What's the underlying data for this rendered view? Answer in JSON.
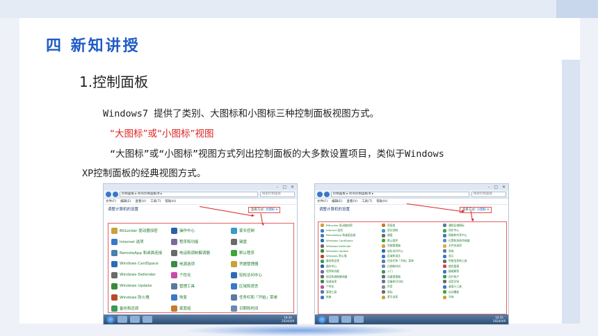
{
  "slide": {
    "section_title": "四 新知讲授",
    "sub_title": "1.控制面板",
    "para1": "Windows7 提供了类别、大图标和小图标三种控制面板视图方式。",
    "para2_highlight": "“大图标”或“小图标”视图",
    "para3": "“大图标”或“小图标”视图方式列出控制面板的大多数设置项目，类似于Windows",
    "para4": "XP控制面板的经典视图方式。"
  },
  "left_window": {
    "path": "控制面板 ▸ 所有控制面板项 ▸",
    "search": "搜索控制面板",
    "menu": [
      "文件(F)",
      "编辑(E)",
      "查看(V)",
      "工具(T)",
      "帮助(H)"
    ],
    "heading": "调整计算机的设置",
    "viewby_label": "查看方式:",
    "viewby_value": "大图标 ▾",
    "items": [
      {
        "label": "BitLocker 驱动器加密",
        "color": "#c9a23a"
      },
      {
        "label": "Internet 选项",
        "color": "#3a78c9"
      },
      {
        "label": "RemoteApp 和桌面连接",
        "color": "#4a7fb0"
      },
      {
        "label": "Windows CardSpace",
        "color": "#2b6cb8"
      },
      {
        "label": "Windows Defender",
        "color": "#6a6a6a"
      },
      {
        "label": "Windows Update",
        "color": "#3a8a3a"
      },
      {
        "label": "Windows 防火墙",
        "color": "#b84a2b"
      },
      {
        "label": "备份和还原",
        "color": "#3a9a5a"
      },
      {
        "label": "操作中心",
        "color": "#2b5fa8"
      },
      {
        "label": "程序和功能",
        "color": "#7a6a9a"
      },
      {
        "label": "电话和调制解调器",
        "color": "#6a6a6a"
      },
      {
        "label": "电源选项",
        "color": "#3a8a4a"
      },
      {
        "label": "个性化",
        "color": "#c84aa8"
      },
      {
        "label": "管理工具",
        "color": "#5a7aa0"
      },
      {
        "label": "恢复",
        "color": "#3a78c9"
      },
      {
        "label": "家庭组",
        "color": "#c87a2b"
      },
      {
        "label": "家长控制",
        "color": "#3a9ac8"
      },
      {
        "label": "键盘",
        "color": "#6a6a6a"
      },
      {
        "label": "默认程序",
        "color": "#3aa83a"
      },
      {
        "label": "凭据管理器",
        "color": "#c8a23a"
      },
      {
        "label": "轻松访问中心",
        "color": "#2b6cb8"
      },
      {
        "label": "区域和语言",
        "color": "#3a78c9"
      },
      {
        "label": "任务栏和「开始」菜单",
        "color": "#5a7aa0"
      },
      {
        "label": "日期和时间",
        "color": "#6a8ab0"
      }
    ],
    "clock_time": "19:34",
    "clock_date": "2024/4/9"
  },
  "right_window": {
    "path": "控制面板 ▸ 所有控制面板项 ▸",
    "search": "搜索控制面板",
    "menu": [
      "文件(F)",
      "编辑(E)",
      "查看(V)",
      "工具(T)",
      "帮助(H)"
    ],
    "heading": "调整计算机的设置",
    "viewby_label": "查看方式:",
    "viewby_value": "小图标 ▾",
    "items": [
      {
        "label": "BitLocker 驱动器加密",
        "color": "#c9a23a"
      },
      {
        "label": "Internet 选项",
        "color": "#3a78c9"
      },
      {
        "label": "RemoteApp 和桌面连接",
        "color": "#4a7fb0"
      },
      {
        "label": "Windows CardSpace",
        "color": "#2b6cb8"
      },
      {
        "label": "Windows Defender",
        "color": "#6a6a6a"
      },
      {
        "label": "Windows Update",
        "color": "#3a8a3a"
      },
      {
        "label": "Windows 防火墙",
        "color": "#b84a2b"
      },
      {
        "label": "备份和还原",
        "color": "#3a9a5a"
      },
      {
        "label": "操作中心",
        "color": "#2b5fa8"
      },
      {
        "label": "程序和功能",
        "color": "#7a6a9a"
      },
      {
        "label": "电话和调制解调器",
        "color": "#6a6a6a"
      },
      {
        "label": "电源选项",
        "color": "#3a8a4a"
      },
      {
        "label": "个性化",
        "color": "#c84aa8"
      },
      {
        "label": "管理工具",
        "color": "#5a7aa0"
      },
      {
        "label": "恢复",
        "color": "#3a78c9"
      },
      {
        "label": "家庭组",
        "color": "#c87a2b"
      },
      {
        "label": "家长控制",
        "color": "#3a9ac8"
      },
      {
        "label": "键盘",
        "color": "#6a6a6a"
      },
      {
        "label": "默认程序",
        "color": "#3aa83a"
      },
      {
        "label": "凭据管理器",
        "color": "#c8a23a"
      },
      {
        "label": "轻松访问中心",
        "color": "#2b6cb8"
      },
      {
        "label": "区域和语言",
        "color": "#3a78c9"
      },
      {
        "label": "任务栏和「开始」菜单",
        "color": "#5a7aa0"
      },
      {
        "label": "日期和时间",
        "color": "#6a8ab0"
      },
      {
        "label": "入门",
        "color": "#3a9a5a"
      },
      {
        "label": "设备管理器",
        "color": "#6a6a6a"
      },
      {
        "label": "设备和打印机",
        "color": "#5a7aa0"
      },
      {
        "label": "声音",
        "color": "#8a8a8a"
      },
      {
        "label": "鼠标",
        "color": "#6a6a6a"
      },
      {
        "label": "索引选项",
        "color": "#c8a23a"
      },
      {
        "label": "通知区域图标",
        "color": "#5a7aa0"
      },
      {
        "label": "同步中心",
        "color": "#3aa83a"
      },
      {
        "label": "网络和共享中心",
        "color": "#3a78c9"
      },
      {
        "label": "位置和其他传感器",
        "color": "#6a8ab0"
      },
      {
        "label": "文件夹选项",
        "color": "#d8b03a"
      },
      {
        "label": "系统",
        "color": "#5a7aa0"
      },
      {
        "label": "显示",
        "color": "#3a78c9"
      },
      {
        "label": "性能信息和工具",
        "color": "#6a6a6a"
      },
      {
        "label": "颜色管理",
        "color": "#c84a4a"
      },
      {
        "label": "疑难解答",
        "color": "#3a78c9"
      },
      {
        "label": "用户帐户",
        "color": "#3a9a5a"
      },
      {
        "label": "语音识别",
        "color": "#6a6a6a"
      },
      {
        "label": "桌面小工具",
        "color": "#3a78c9"
      },
      {
        "label": "自动播放",
        "color": "#3aa83a"
      },
      {
        "label": "字体",
        "color": "#c8a23a"
      }
    ],
    "clock_time": "19:35",
    "clock_date": "2024/4/9"
  }
}
